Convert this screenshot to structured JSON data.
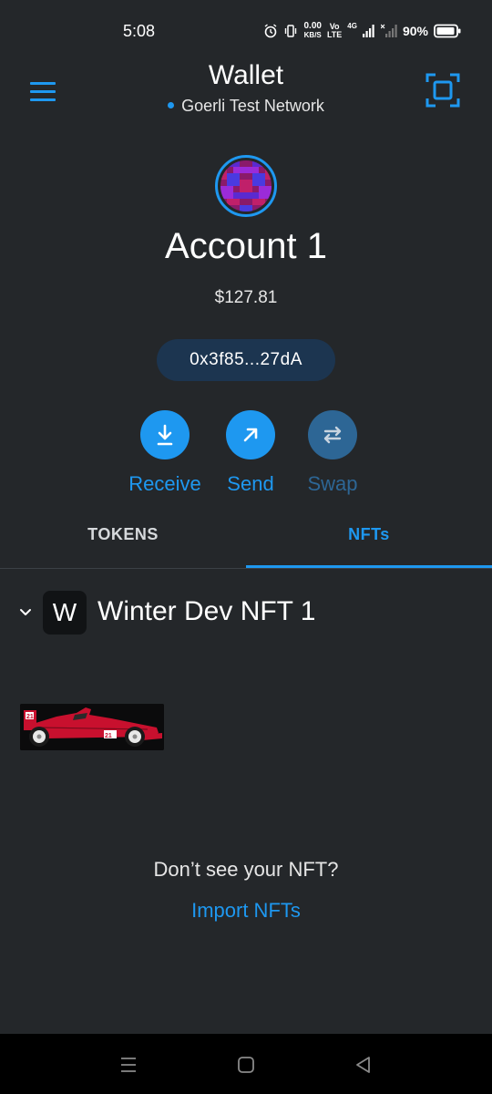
{
  "status_bar": {
    "time": "5:08",
    "speed_value": "0.00",
    "speed_unit": "KB/S",
    "volte_top": "Vo",
    "volte_bottom": "LTE",
    "network_type": "4G",
    "battery": "90%"
  },
  "header": {
    "title": "Wallet",
    "network": "Goerli Test Network",
    "menu_icon": "hamburger-menu-icon",
    "scan_icon": "qr-scan-icon"
  },
  "account": {
    "name": "Account 1",
    "balance": "$127.81",
    "address": "0x3f85...27dA"
  },
  "actions": {
    "receive": "Receive",
    "send": "Send",
    "swap": "Swap"
  },
  "tabs": {
    "tokens": "TOKENS",
    "nfts": "NFTs",
    "active": "NFTs"
  },
  "collection": {
    "badge": "W",
    "name": "Winter Dev NFT 1"
  },
  "import": {
    "prompt": "Don’t see your NFT?",
    "link": "Import NFTs"
  },
  "colors": {
    "accent": "#1e98f0",
    "background": "#24272a",
    "disabled_accent": "#2d6695"
  }
}
